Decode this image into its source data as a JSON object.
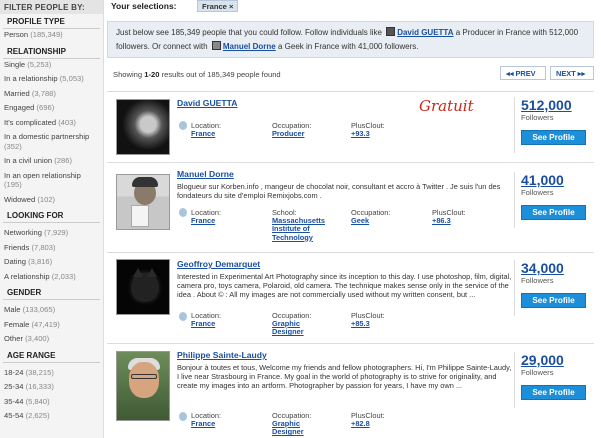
{
  "sidebar": {
    "header": "FILTER PEOPLE BY:",
    "sections": [
      {
        "title": "PROFILE TYPE",
        "items": [
          {
            "label": "Person",
            "count": "(185,349)"
          }
        ]
      },
      {
        "title": "RELATIONSHIP",
        "items": [
          {
            "label": "Single",
            "count": "(5,253)"
          },
          {
            "label": "In a relationship",
            "count": "(5,053)"
          },
          {
            "label": "Married",
            "count": "(3,788)"
          },
          {
            "label": "Engaged",
            "count": "(696)"
          },
          {
            "label": "It's complicated",
            "count": "(403)"
          },
          {
            "label": "In a domestic partnership",
            "count": "(352)"
          },
          {
            "label": "In a civil union",
            "count": "(286)"
          },
          {
            "label": "In an open relationship",
            "count": "(195)"
          },
          {
            "label": "Widowed",
            "count": "(102)"
          }
        ]
      },
      {
        "title": "LOOKING FOR",
        "items": [
          {
            "label": "Networking",
            "count": "(7,929)"
          },
          {
            "label": "Friends",
            "count": "(7,803)"
          },
          {
            "label": "Dating",
            "count": "(3,816)"
          },
          {
            "label": "A relationship",
            "count": "(2,033)"
          }
        ]
      },
      {
        "title": "GENDER",
        "items": [
          {
            "label": "Male",
            "count": "(133,065)"
          },
          {
            "label": "Female",
            "count": "(47,419)"
          },
          {
            "label": "Other",
            "count": "(3,400)"
          }
        ]
      },
      {
        "title": "AGE RANGE",
        "items": [
          {
            "label": "18-24",
            "count": "(38,215)"
          },
          {
            "label": "25-34",
            "count": "(16,333)"
          },
          {
            "label": "35-44",
            "count": "(5,840)"
          },
          {
            "label": "45-54",
            "count": "(2,625)"
          }
        ]
      }
    ]
  },
  "topbar": {
    "label": "Your selections:",
    "chip": "France ×"
  },
  "info": {
    "part1": "Just below see 185,349 people that you could follow. Follow individuals like",
    "link1": "David GUETTA",
    "part2": "a Producer in France with 512,000 followers. Or connect with",
    "link2": "Manuel Dorne",
    "part3": "a Geek in France with 41,000 followers."
  },
  "results": {
    "prefix": "Showing",
    "range": "1-20",
    "suffix": "results out of 185,349 people found",
    "prev": "◂◂  PREV",
    "next": "NEXT  ▸▸"
  },
  "people": [
    {
      "name": "David GUETTA",
      "desc": "",
      "location_label": "Location:",
      "location": "France",
      "occupation_label": "Occupation:",
      "occupation": "Producer",
      "plusclout_label": "PlusClout:",
      "plusclout": "+93.3",
      "followers": "512,000",
      "followers_label": "Followers",
      "button": "See Profile",
      "annotation": "Gratuit"
    },
    {
      "name": "Manuel Dorne",
      "desc": "Blogueur sur Korben.info , mangeur de chocolat noir, consultant et accro à Twitter . Je suis l'un des fondateurs du site d'emploi Remixjobs.com .",
      "location_label": "Location:",
      "location": "France",
      "school_label": "School:",
      "school": "Massachusetts Institute of Technology",
      "occupation_label": "Occupation:",
      "occupation": "Geek",
      "plusclout_label": "PlusClout:",
      "plusclout": "+86.3",
      "followers": "41,000",
      "followers_label": "Followers",
      "button": "See Profile"
    },
    {
      "name": "Geoffroy Demarquet",
      "desc": "Interested in Experimental Art Photography since its inception to this day. I use photoshop, film, digital, camera pro, toys camera, Polaroid, old camera. The technique makes sense only in the service of the idea . About © : All my images are not commercially used without my written consent, but ...",
      "location_label": "Location:",
      "location": "France",
      "occupation_label": "Occupation:",
      "occupation": "Graphic Designer",
      "plusclout_label": "PlusClout:",
      "plusclout": "+85.3",
      "followers": "34,000",
      "followers_label": "Followers",
      "button": "See Profile"
    },
    {
      "name": "Philippe Sainte-Laudy",
      "desc": "Bonjour à toutes et tous, Welcome my friends and fellow photographers. Hi, I'm Philippe Sainte-Laudy, I live near Strasbourg in France. My goal in the world of photography is to strive for originality, and create my images into an artform. Photographer by passion for years, I have my own ...",
      "location_label": "Location:",
      "location": "France",
      "occupation_label": "Occupation:",
      "occupation": "Graphic Designer",
      "plusclout_label": "PlusClout:",
      "plusclout": "+82.8",
      "followers": "29,000",
      "followers_label": "Followers",
      "button": "See Profile"
    }
  ]
}
